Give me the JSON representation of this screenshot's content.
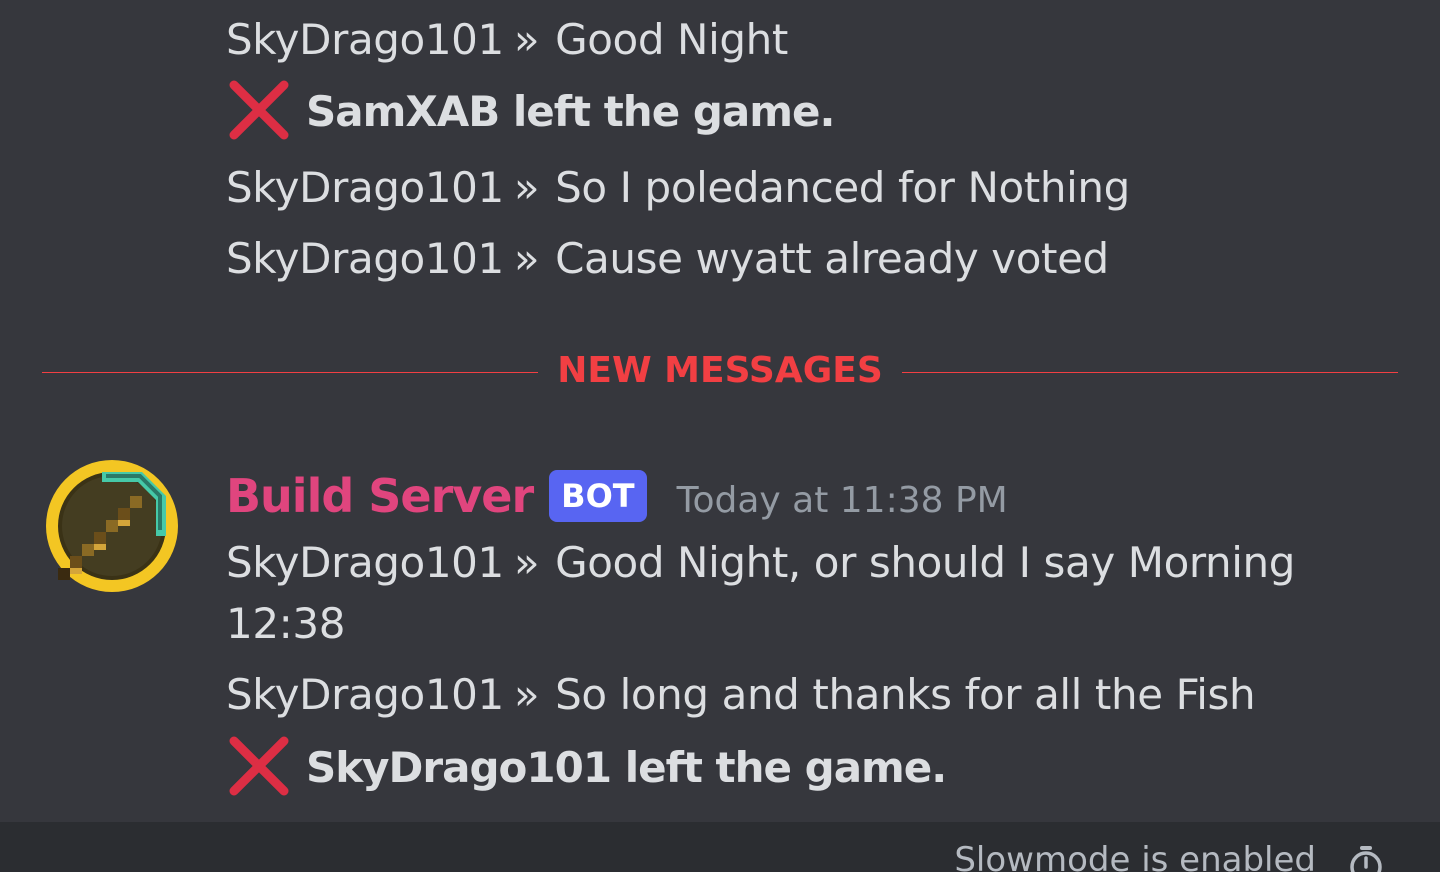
{
  "messages_above": [
    {
      "sender": "SkyDrago101",
      "arrow": "»",
      "text": "Good Night"
    },
    {
      "event": "SamXAB left the game.",
      "icon": "red-x-icon"
    },
    {
      "sender": "SkyDrago101",
      "arrow": "»",
      "text": "So I poledanced for Nothing"
    },
    {
      "sender": "SkyDrago101",
      "arrow": "»",
      "text": "Cause wyatt already voted"
    }
  ],
  "divider": {
    "label": "NEW MESSAGES",
    "color": "#f23f43"
  },
  "new_group": {
    "username": "Build Server",
    "username_color": "#e0457e",
    "badge": "BOT",
    "badge_color": "#5865f2",
    "timestamp": "Today at 11:38 PM",
    "avatar_icon": "pickaxe-icon",
    "messages": [
      {
        "sender": "SkyDrago101",
        "arrow": "»",
        "text": "Good Night, or should I say Morning",
        "continuation": "12:38"
      },
      {
        "sender": "SkyDrago101",
        "arrow": "»",
        "text": "So long and thanks for all the Fish"
      },
      {
        "event": "SkyDrago101 left the game.",
        "icon": "red-x-icon"
      }
    ]
  },
  "footer": {
    "slowmode_text": "Slowmode is enabled",
    "icon": "timer-icon"
  }
}
